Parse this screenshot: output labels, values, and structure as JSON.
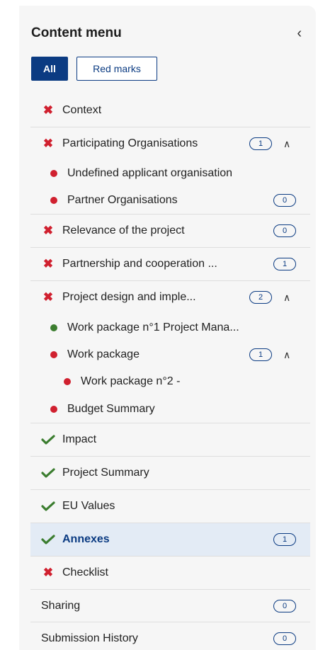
{
  "panel": {
    "title": "Content menu",
    "collapse_icon": "chevron-left-icon"
  },
  "filters": {
    "all_label": "All",
    "red_marks_label": "Red marks"
  },
  "colors": {
    "primary": "#0b3b82",
    "error": "#d0202f",
    "success": "#3b7d2f",
    "active_bg": "#e3ebf5"
  },
  "menu": {
    "context": {
      "label": "Context",
      "status": "error"
    },
    "participating": {
      "label": "Participating Organisations",
      "count": "1",
      "expanded": true,
      "status": "error"
    },
    "undefined_applicant": {
      "label": "Undefined applicant organisation",
      "status": "error"
    },
    "partner_orgs": {
      "label": "Partner Organisations",
      "count": "0",
      "status": "error"
    },
    "relevance": {
      "label": "Relevance of the project",
      "count": "0",
      "status": "error"
    },
    "partnership": {
      "label": "Partnership and cooperation ...",
      "count": "1",
      "status": "error"
    },
    "project_design": {
      "label": "Project design and imple...",
      "count": "2",
      "expanded": true,
      "status": "error"
    },
    "wp1": {
      "label": "Work package n°1 Project Mana...",
      "status": "success"
    },
    "work_package": {
      "label": "Work package",
      "count": "1",
      "expanded": true,
      "status": "error"
    },
    "wp2": {
      "label": "Work package n°2 -",
      "status": "error"
    },
    "budget": {
      "label": "Budget Summary",
      "status": "error"
    },
    "impact": {
      "label": "Impact",
      "status": "success"
    },
    "project_summary": {
      "label": "Project Summary",
      "status": "success"
    },
    "eu_values": {
      "label": "EU Values",
      "status": "success"
    },
    "annexes": {
      "label": "Annexes",
      "count": "1",
      "status": "success",
      "active": true
    },
    "checklist": {
      "label": "Checklist",
      "status": "error"
    },
    "sharing": {
      "label": "Sharing",
      "count": "0"
    },
    "submission_history": {
      "label": "Submission History",
      "count": "0"
    }
  }
}
